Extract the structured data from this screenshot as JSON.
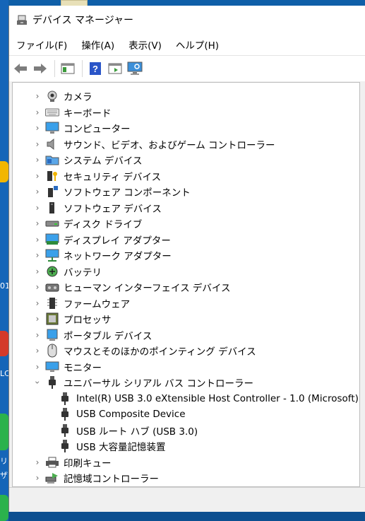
{
  "window": {
    "title": "デバイス マネージャー"
  },
  "menu": [
    {
      "label": "ファイル(F)"
    },
    {
      "label": "操作(A)"
    },
    {
      "label": "表示(V)"
    },
    {
      "label": "ヘルプ(H)"
    }
  ],
  "toolbar": [
    {
      "name": "back-button",
      "icon": "back-arrow-icon"
    },
    {
      "name": "forward-button",
      "icon": "forward-arrow-icon"
    },
    {
      "name": "properties-button",
      "icon": "properties-icon"
    },
    {
      "name": "help-button",
      "icon": "help-icon"
    },
    {
      "name": "update-driver-button",
      "icon": "update-driver-icon"
    },
    {
      "name": "scan-hardware-button",
      "icon": "monitor-scan-icon"
    }
  ],
  "tree": {
    "items": [
      {
        "label": "カメラ",
        "icon": "camera-icon",
        "expanded": false
      },
      {
        "label": "キーボード",
        "icon": "keyboard-icon",
        "expanded": false
      },
      {
        "label": "コンピューター",
        "icon": "computer-icon",
        "expanded": false
      },
      {
        "label": "サウンド、ビデオ、およびゲーム コントローラー",
        "icon": "speaker-icon",
        "expanded": false
      },
      {
        "label": "システム デバイス",
        "icon": "system-folder-icon",
        "expanded": false
      },
      {
        "label": "セキュリティ デバイス",
        "icon": "security-key-icon",
        "expanded": false
      },
      {
        "label": "ソフトウェア コンポーネント",
        "icon": "software-component-icon",
        "expanded": false
      },
      {
        "label": "ソフトウェア デバイス",
        "icon": "software-device-icon",
        "expanded": false
      },
      {
        "label": "ディスク ドライブ",
        "icon": "disk-drive-icon",
        "expanded": false
      },
      {
        "label": "ディスプレイ アダプター",
        "icon": "display-adapter-icon",
        "expanded": false
      },
      {
        "label": "ネットワーク アダプター",
        "icon": "network-adapter-icon",
        "expanded": false
      },
      {
        "label": "バッテリ",
        "icon": "battery-icon",
        "expanded": false
      },
      {
        "label": "ヒューマン インターフェイス デバイス",
        "icon": "hid-icon",
        "expanded": false
      },
      {
        "label": "ファームウェア",
        "icon": "firmware-icon",
        "expanded": false
      },
      {
        "label": "プロセッサ",
        "icon": "processor-icon",
        "expanded": false
      },
      {
        "label": "ポータブル デバイス",
        "icon": "portable-device-icon",
        "expanded": false
      },
      {
        "label": "マウスとそのほかのポインティング デバイス",
        "icon": "mouse-icon",
        "expanded": false
      },
      {
        "label": "モニター",
        "icon": "monitor-icon",
        "expanded": false
      },
      {
        "label": "ユニバーサル シリアル バス コントローラー",
        "icon": "usb-icon",
        "expanded": true,
        "children": [
          {
            "label": "Intel(R) USB 3.0 eXtensible Host Controller - 1.0 (Microsoft)",
            "icon": "usb-icon"
          },
          {
            "label": "USB Composite Device",
            "icon": "usb-icon"
          },
          {
            "label": "USB ルート ハブ (USB 3.0)",
            "icon": "usb-icon"
          },
          {
            "label": "USB 大容量記憶装置",
            "icon": "usb-icon"
          }
        ]
      },
      {
        "label": "印刷キュー",
        "icon": "printer-icon",
        "expanded": false
      },
      {
        "label": "記憶域コントローラー",
        "icon": "storage-controller-icon",
        "expanded": false
      }
    ]
  },
  "desktop": {
    "fragments": [
      "01",
      "LC",
      "リ",
      "ザ"
    ]
  }
}
